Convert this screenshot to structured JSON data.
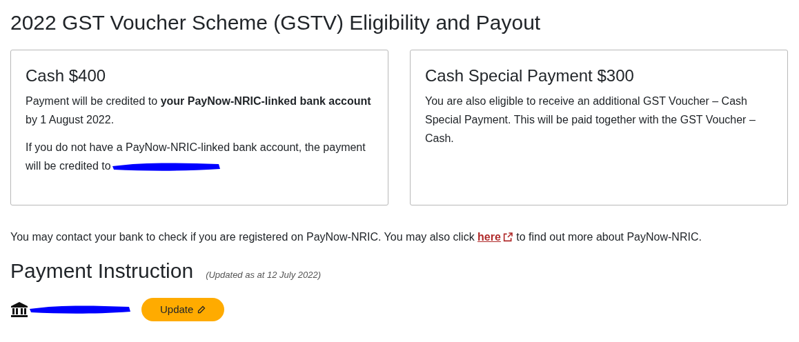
{
  "title": "2022 GST Voucher Scheme (GSTV) Eligibility and Payout",
  "cards": [
    {
      "title": "Cash $400",
      "paragraphs": [
        {
          "text": "Payment will be credited to **your PayNow-NRIC-linked bank account** by 1 August 2022.",
          "redacted": false
        },
        {
          "text": "If you do not have a PayNow-NRIC-linked bank account, the payment will be credited to",
          "redacted": true
        }
      ]
    },
    {
      "title": "Cash Special Payment $300",
      "paragraphs": [
        {
          "text": "You are also eligible to receive an additional GST Voucher – Cash Special Payment. This will be paid together with the GST Voucher – Cash.",
          "redacted": false
        }
      ]
    }
  ],
  "note": {
    "before": "You may contact your bank to check if you are registered on PayNow-NRIC. You may also click",
    "link": "here",
    "after": "to find out more about PayNow-NRIC."
  },
  "payment_instruction": {
    "heading": "Payment Instruction",
    "updated": "(Updated as at 12 July 2022)",
    "button": "Update"
  }
}
